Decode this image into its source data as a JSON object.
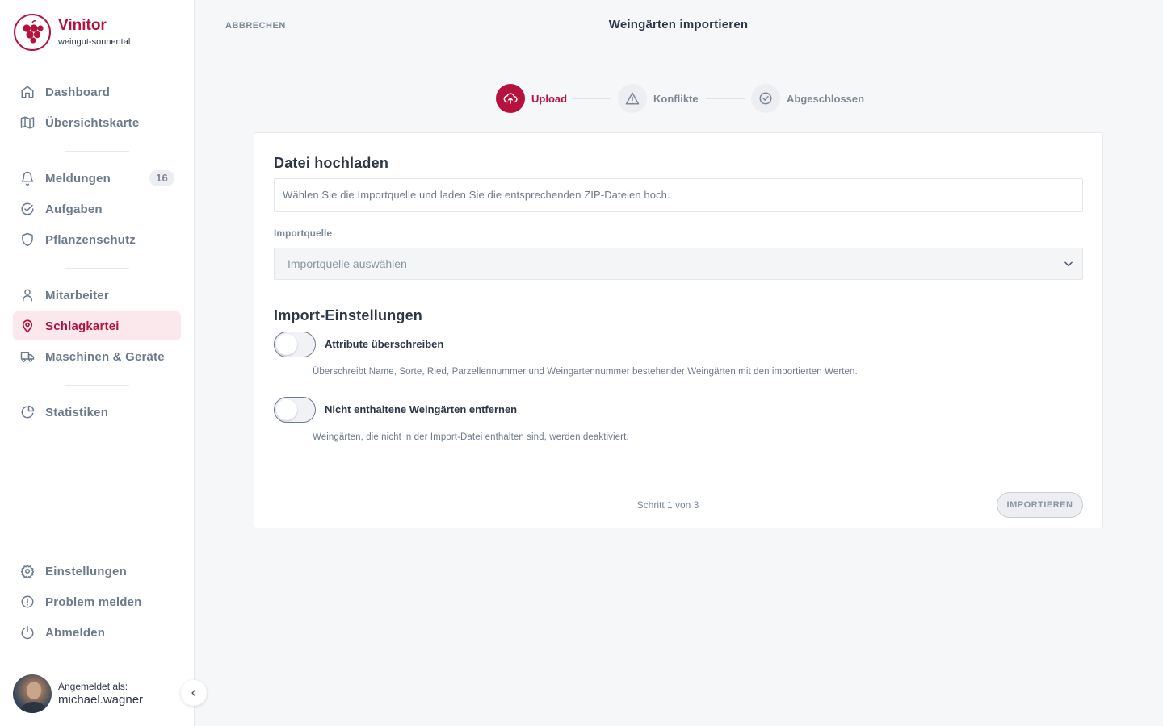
{
  "brand": {
    "name": "Vinitor",
    "subtitle": "weingut-sonnental",
    "logo": "grape-logo",
    "color": "#b5123e"
  },
  "sidebar": {
    "items": [
      {
        "label": "Dashboard",
        "icon": "home-icon"
      },
      {
        "label": "Übersichtskarte",
        "icon": "map-icon"
      },
      {
        "label": "Meldungen",
        "icon": "bell-icon",
        "badge": "16"
      },
      {
        "label": "Aufgaben",
        "icon": "check-circle-icon"
      },
      {
        "label": "Pflanzenschutz",
        "icon": "shield-icon"
      },
      {
        "label": "Mitarbeiter",
        "icon": "user-icon"
      },
      {
        "label": "Schlagkartei",
        "icon": "map-pin-icon",
        "active": true
      },
      {
        "label": "Maschinen & Geräte",
        "icon": "truck-icon"
      },
      {
        "label": "Statistiken",
        "icon": "pie-chart-icon"
      }
    ],
    "bottom": [
      {
        "label": "Einstellungen",
        "icon": "gear-icon"
      },
      {
        "label": "Problem melden",
        "icon": "alert-circle-icon"
      },
      {
        "label": "Abmelden",
        "icon": "power-icon"
      }
    ],
    "user": {
      "label": "Angemeldet als:",
      "name": "michael.wagner"
    }
  },
  "header": {
    "cancel": "ABBRECHEN",
    "title": "Weingärten importieren"
  },
  "stepper": [
    {
      "label": "Upload",
      "icon": "upload-cloud-icon",
      "active": true
    },
    {
      "label": "Konflikte",
      "icon": "warning-icon"
    },
    {
      "label": "Abgeschlossen",
      "icon": "check-circle-icon"
    }
  ],
  "card": {
    "title": "Datei hochladen",
    "info": "Wählen Sie die Importquelle und laden Sie die entsprechenden ZIP-Dateien hoch.",
    "source_label": "Importquelle",
    "source_placeholder": "Importquelle auswählen",
    "settings_title": "Import-Einstellungen",
    "toggles": [
      {
        "label": "Attribute überschreiben",
        "description": "Überschreibt Name, Sorte, Ried, Parzellennummer und Weingartennummer bestehender Weingärten mit den importierten Werten.",
        "on": false
      },
      {
        "label": "Nicht enthaltene Weingärten entfernen",
        "description": "Weingärten, die nicht in der Import-Datei enthalten sind, werden deaktiviert.",
        "on": false
      }
    ],
    "step_count": "Schritt 1 von 3",
    "import_button": "IMPORTIEREN"
  }
}
